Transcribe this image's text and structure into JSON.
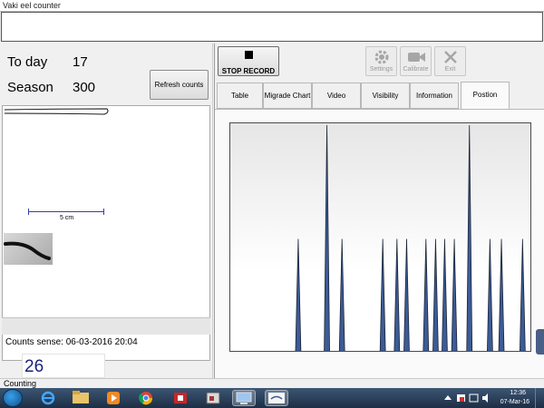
{
  "window": {
    "title": "Vaki eel counter"
  },
  "stats": {
    "today_label": "To day",
    "today_value": "17",
    "season_label": "Season",
    "season_value": "300"
  },
  "buttons": {
    "refresh": "Refresh counts",
    "stop_record": "STOP RECORD",
    "settings": "Settings",
    "calibrate": "Calibrate",
    "exit": "Exit"
  },
  "image_panel": {
    "scale_label": "5 cm"
  },
  "counts": {
    "sense_text": "Counts sense: 06-03-2016 20:04",
    "current_count": "26"
  },
  "tabs": [
    {
      "label": "Table",
      "active": false
    },
    {
      "label": "Migrade Chart",
      "active": false
    },
    {
      "label": "Video",
      "active": false
    },
    {
      "label": "Visibility",
      "active": false
    },
    {
      "label": "Information",
      "active": false
    },
    {
      "label": "Postion",
      "active": true
    }
  ],
  "status": {
    "text": "Counting"
  },
  "taskbar": {
    "apps": [
      "start-orb",
      "internet-explorer",
      "file-explorer",
      "media-player",
      "chrome",
      "app-red",
      "app-window",
      "app-network",
      "vaki-app"
    ],
    "clock_time": "12:36",
    "clock_date": "07-Mar-16"
  },
  "colors": {
    "bar_fill": "#3d5b95",
    "bar_stroke": "#1b2436",
    "count_text": "#1b1f7c"
  },
  "chart_data": {
    "type": "bar",
    "title": "",
    "xlabel": "",
    "ylabel": "",
    "ylim": [
      0,
      1
    ],
    "grid": false,
    "series": [
      {
        "points": [
          {
            "x": 0.225,
            "y": 0.5
          },
          {
            "x": 0.32,
            "y": 1.0
          },
          {
            "x": 0.37,
            "y": 0.5
          },
          {
            "x": 0.505,
            "y": 0.5
          },
          {
            "x": 0.552,
            "y": 0.5
          },
          {
            "x": 0.584,
            "y": 0.5
          },
          {
            "x": 0.648,
            "y": 0.5
          },
          {
            "x": 0.68,
            "y": 0.5
          },
          {
            "x": 0.71,
            "y": 0.5
          },
          {
            "x": 0.742,
            "y": 0.5
          },
          {
            "x": 0.792,
            "y": 1.0
          },
          {
            "x": 0.86,
            "y": 0.5
          },
          {
            "x": 0.898,
            "y": 0.5
          },
          {
            "x": 0.968,
            "y": 0.5
          }
        ]
      }
    ]
  }
}
